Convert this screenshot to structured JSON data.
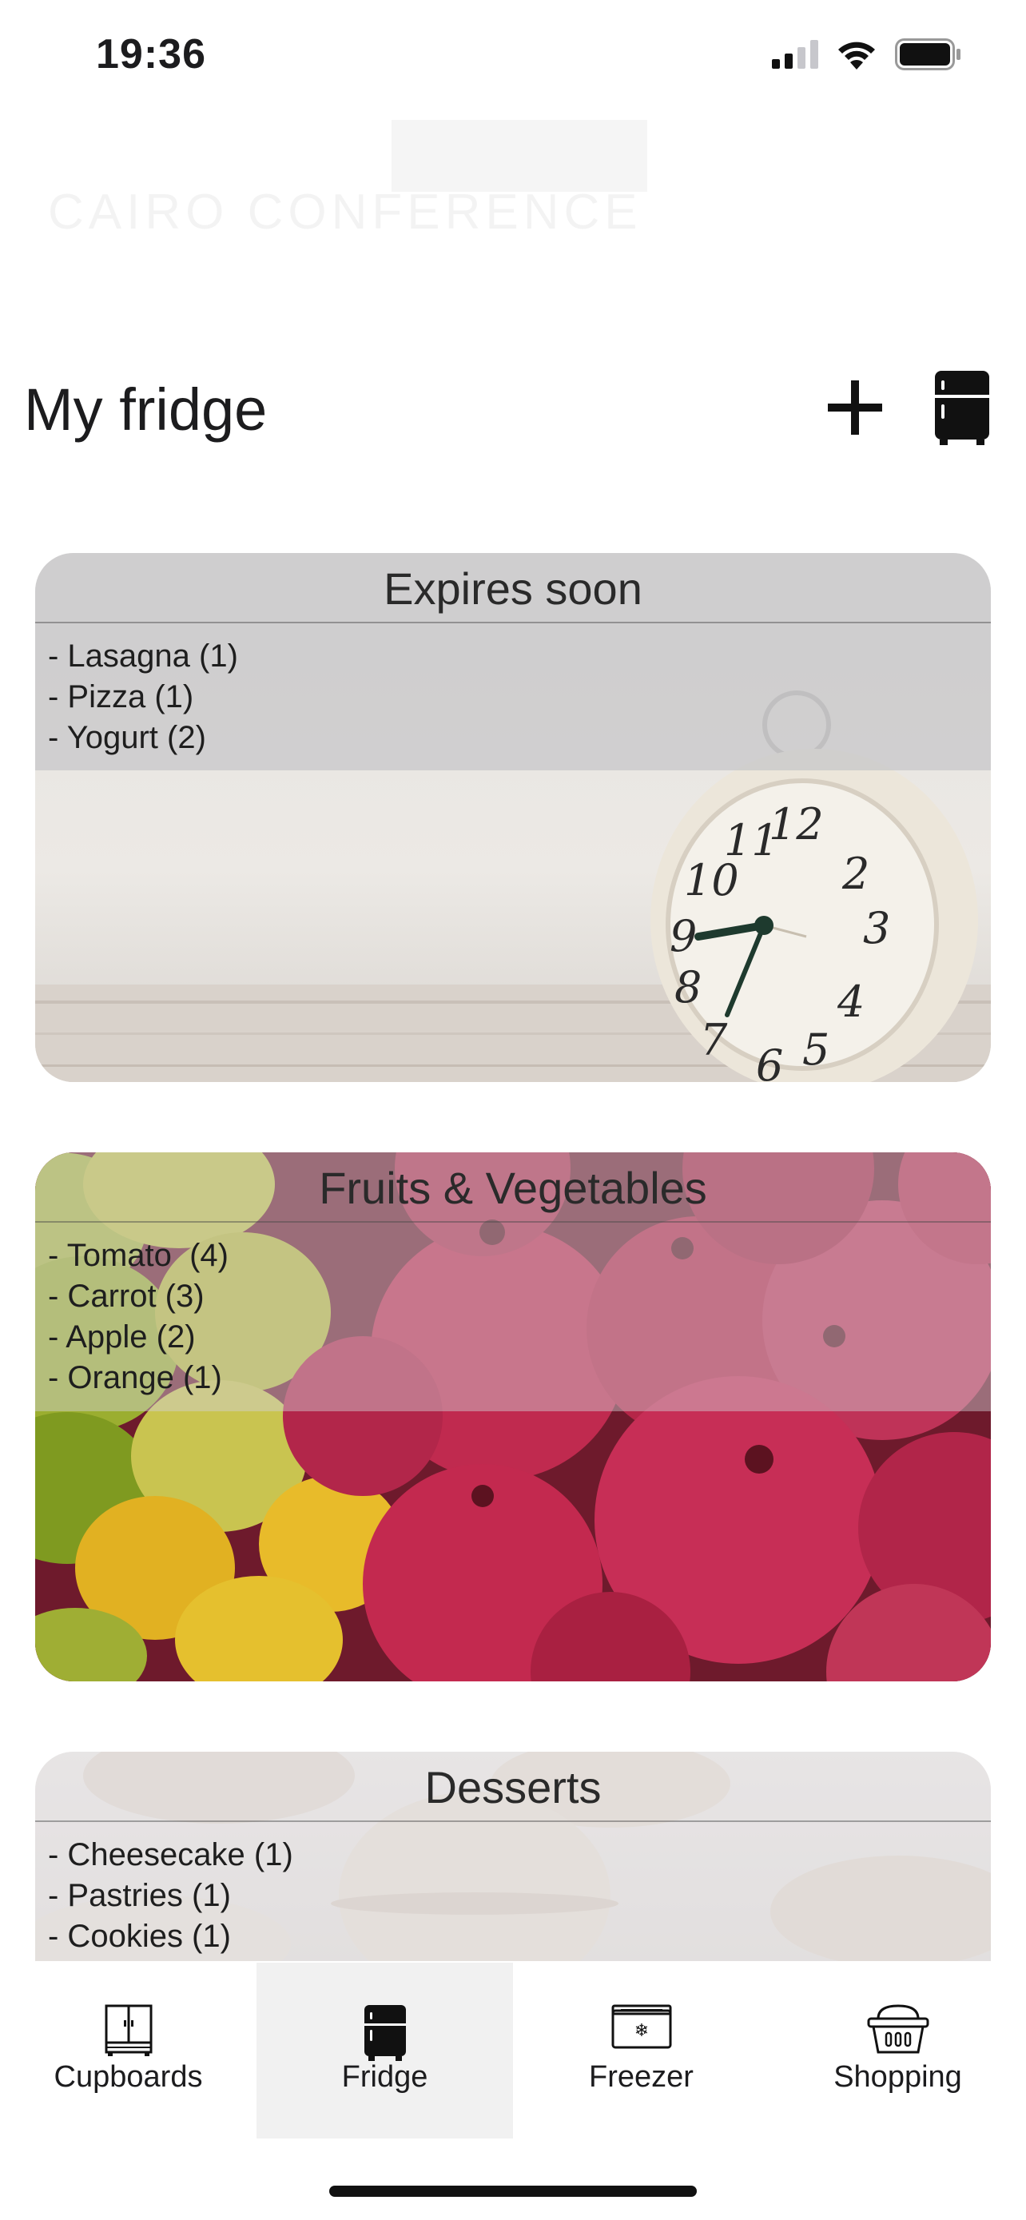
{
  "status_bar": {
    "time": "19:36",
    "icons": [
      "signal-icon",
      "wifi-icon",
      "battery-icon"
    ]
  },
  "background_logo": {
    "text": "CAIRO CONFERENCE"
  },
  "header": {
    "title": "My fridge",
    "add_icon": "plus-icon",
    "fridge_icon": "fridge-icon"
  },
  "cards": [
    {
      "title": "Expires soon",
      "items": [
        "- Lasagna (1)",
        "- Pizza (1)",
        "- Yogurt (2)"
      ],
      "image": "alarm-clock"
    },
    {
      "title": "Fruits & Vegetables",
      "items": [
        "- Tomato  (4)",
        "- Carrot (3)",
        "- Apple (2)",
        "- Orange (1)"
      ],
      "image": "pomegranates-and-lemons"
    },
    {
      "title": "Desserts",
      "items": [
        "- Cheesecake (1)",
        "- Pastries (1)",
        "- Cookies (1)"
      ],
      "image": "macarons"
    }
  ],
  "tabs": [
    {
      "label": "Cupboards",
      "icon": "cupboard-icon",
      "active": false
    },
    {
      "label": "Fridge",
      "icon": "fridge-icon",
      "active": true
    },
    {
      "label": "Freezer",
      "icon": "freezer-icon",
      "active": false
    },
    {
      "label": "Shopping",
      "icon": "basket-icon",
      "active": false
    }
  ],
  "colors": {
    "text": "#1c1c1e",
    "active_tab_bg": "#f1f1f1",
    "card_band": "#c4c4c8"
  }
}
